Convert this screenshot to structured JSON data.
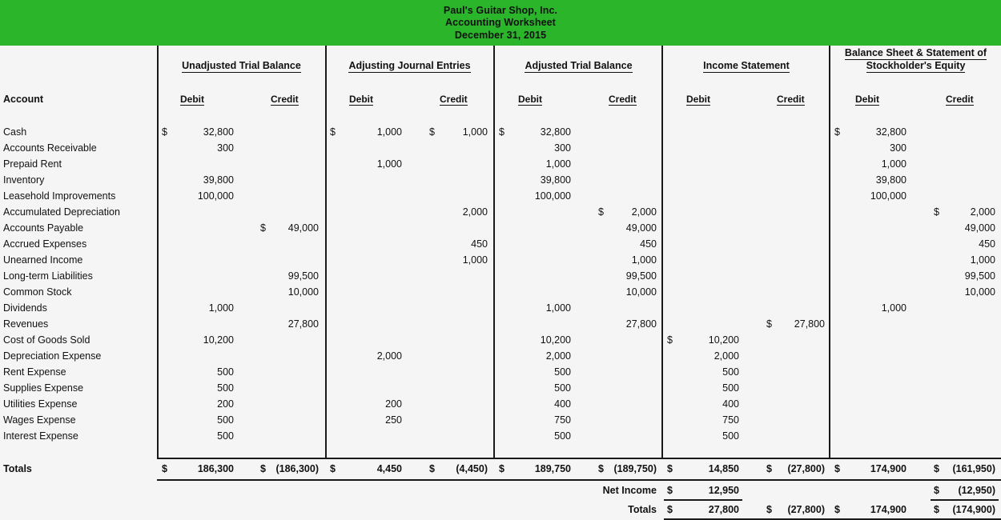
{
  "header": {
    "company": "Paul's Guitar Shop, Inc.",
    "doc_title": "Accounting Worksheet",
    "date": "December 31, 2015",
    "band_color": "#2bb52b"
  },
  "columns": {
    "account_label": "Account",
    "groups": [
      {
        "label": "Unadjusted Trial Balance"
      },
      {
        "label": "Adjusting Journal Entries"
      },
      {
        "label": "Adjusted Trial Balance"
      },
      {
        "label": "Income Statement"
      },
      {
        "label": "Balance Sheet & Statement of",
        "label2": "Stockholder's Equity"
      }
    ],
    "debit_label": "Debit",
    "credit_label": "Credit",
    "currency_symbol": "$"
  },
  "rows": [
    {
      "account": "Cash",
      "utb_d": "32,800",
      "utb_d_cur": "$",
      "utb_c": "",
      "aje_d": "1,000",
      "aje_d_cur": "$",
      "aje_c": "1,000",
      "aje_c_cur": "$",
      "atb_d": "32,800",
      "atb_d_cur": "$",
      "atb_c": "",
      "is_d": "",
      "is_c": "",
      "bs_d": "32,800",
      "bs_d_cur": "$",
      "bs_c": ""
    },
    {
      "account": "Accounts Receivable",
      "utb_d": "300",
      "utb_c": "",
      "aje_d": "",
      "aje_c": "",
      "atb_d": "300",
      "atb_c": "",
      "is_d": "",
      "is_c": "",
      "bs_d": "300",
      "bs_c": ""
    },
    {
      "account": "Prepaid Rent",
      "utb_d": "",
      "utb_c": "",
      "aje_d": "1,000",
      "aje_c": "",
      "atb_d": "1,000",
      "atb_c": "",
      "is_d": "",
      "is_c": "",
      "bs_d": "1,000",
      "bs_c": ""
    },
    {
      "account": "Inventory",
      "utb_d": "39,800",
      "utb_c": "",
      "aje_d": "",
      "aje_c": "",
      "atb_d": "39,800",
      "atb_c": "",
      "is_d": "",
      "is_c": "",
      "bs_d": "39,800",
      "bs_c": ""
    },
    {
      "account": "Leasehold Improvements",
      "utb_d": "100,000",
      "utb_c": "",
      "aje_d": "",
      "aje_c": "",
      "atb_d": "100,000",
      "atb_c": "",
      "is_d": "",
      "is_c": "",
      "bs_d": "100,000",
      "bs_c": ""
    },
    {
      "account": "Accumulated Depreciation",
      "utb_d": "",
      "utb_c": "",
      "aje_d": "",
      "aje_c": "2,000",
      "atb_d": "",
      "atb_c": "2,000",
      "atb_c_cur": "$",
      "is_d": "",
      "is_c": "",
      "bs_d": "",
      "bs_c": "2,000",
      "bs_c_cur": "$"
    },
    {
      "account": "Accounts Payable",
      "utb_d": "",
      "utb_c": "49,000",
      "utb_c_cur": "$",
      "aje_d": "",
      "aje_c": "",
      "atb_d": "",
      "atb_c": "49,000",
      "is_d": "",
      "is_c": "",
      "bs_d": "",
      "bs_c": "49,000"
    },
    {
      "account": "Accrued Expenses",
      "utb_d": "",
      "utb_c": "",
      "aje_d": "",
      "aje_c": "450",
      "atb_d": "",
      "atb_c": "450",
      "is_d": "",
      "is_c": "",
      "bs_d": "",
      "bs_c": "450"
    },
    {
      "account": "Unearned Income",
      "utb_d": "",
      "utb_c": "",
      "aje_d": "",
      "aje_c": "1,000",
      "atb_d": "",
      "atb_c": "1,000",
      "is_d": "",
      "is_c": "",
      "bs_d": "",
      "bs_c": "1,000"
    },
    {
      "account": "Long-term Liabilities",
      "utb_d": "",
      "utb_c": "99,500",
      "aje_d": "",
      "aje_c": "",
      "atb_d": "",
      "atb_c": "99,500",
      "is_d": "",
      "is_c": "",
      "bs_d": "",
      "bs_c": "99,500"
    },
    {
      "account": "Common Stock",
      "utb_d": "",
      "utb_c": "10,000",
      "aje_d": "",
      "aje_c": "",
      "atb_d": "",
      "atb_c": "10,000",
      "is_d": "",
      "is_c": "",
      "bs_d": "",
      "bs_c": "10,000"
    },
    {
      "account": "Dividends",
      "utb_d": "1,000",
      "utb_c": "",
      "aje_d": "",
      "aje_c": "",
      "atb_d": "1,000",
      "atb_c": "",
      "is_d": "",
      "is_c": "",
      "bs_d": "1,000",
      "bs_c": ""
    },
    {
      "account": "Revenues",
      "utb_d": "",
      "utb_c": "27,800",
      "aje_d": "",
      "aje_c": "",
      "atb_d": "",
      "atb_c": "27,800",
      "is_d": "",
      "is_c": "27,800",
      "is_c_cur": "$",
      "bs_d": "",
      "bs_c": ""
    },
    {
      "account": "Cost of Goods Sold",
      "utb_d": "10,200",
      "utb_c": "",
      "aje_d": "",
      "aje_c": "",
      "atb_d": "10,200",
      "atb_c": "",
      "is_d": "10,200",
      "is_d_cur": "$",
      "is_c": "",
      "bs_d": "",
      "bs_c": ""
    },
    {
      "account": "Depreciation Expense",
      "utb_d": "",
      "utb_c": "",
      "aje_d": "2,000",
      "aje_c": "",
      "atb_d": "2,000",
      "atb_c": "",
      "is_d": "2,000",
      "is_c": "",
      "bs_d": "",
      "bs_c": ""
    },
    {
      "account": "Rent Expense",
      "utb_d": "500",
      "utb_c": "",
      "aje_d": "",
      "aje_c": "",
      "atb_d": "500",
      "atb_c": "",
      "is_d": "500",
      "is_c": "",
      "bs_d": "",
      "bs_c": ""
    },
    {
      "account": "Supplies Expense",
      "utb_d": "500",
      "utb_c": "",
      "aje_d": "",
      "aje_c": "",
      "atb_d": "500",
      "atb_c": "",
      "is_d": "500",
      "is_c": "",
      "bs_d": "",
      "bs_c": ""
    },
    {
      "account": "Utilities Expense",
      "utb_d": "200",
      "utb_c": "",
      "aje_d": "200",
      "aje_c": "",
      "atb_d": "400",
      "atb_c": "",
      "is_d": "400",
      "is_c": "",
      "bs_d": "",
      "bs_c": ""
    },
    {
      "account": "Wages Expense",
      "utb_d": "500",
      "utb_c": "",
      "aje_d": "250",
      "aje_c": "",
      "atb_d": "750",
      "atb_c": "",
      "is_d": "750",
      "is_c": "",
      "bs_d": "",
      "bs_c": ""
    },
    {
      "account": "Interest Expense",
      "utb_d": "500",
      "utb_c": "",
      "aje_d": "",
      "aje_c": "",
      "atb_d": "500",
      "atb_c": "",
      "is_d": "500",
      "is_c": "",
      "bs_d": "",
      "bs_c": ""
    }
  ],
  "totals": {
    "label": "Totals",
    "utb_d": "186,300",
    "utb_d_cur": "$",
    "utb_c": "(186,300)",
    "utb_c_cur": "$",
    "aje_d": "4,450",
    "aje_d_cur": "$",
    "aje_c": "(4,450)",
    "aje_c_cur": "$",
    "atb_d": "189,750",
    "atb_d_cur": "$",
    "atb_c": "(189,750)",
    "atb_c_cur": "$",
    "is_d": "14,850",
    "is_d_cur": "$",
    "is_c": "(27,800)",
    "is_c_cur": "$",
    "bs_d": "174,900",
    "bs_d_cur": "$",
    "bs_c": "(161,950)",
    "bs_c_cur": "$"
  },
  "net_income": {
    "label": "Net Income",
    "is_d": "12,950",
    "is_d_cur": "$",
    "is_c": "",
    "bs_d": "",
    "bs_c": "(12,950)",
    "bs_c_cur": "$"
  },
  "final_totals": {
    "label": "Totals",
    "is_d": "27,800",
    "is_d_cur": "$",
    "is_c": "(27,800)",
    "is_c_cur": "$",
    "bs_d": "174,900",
    "bs_d_cur": "$",
    "bs_c": "(174,900)",
    "bs_c_cur": "$"
  }
}
